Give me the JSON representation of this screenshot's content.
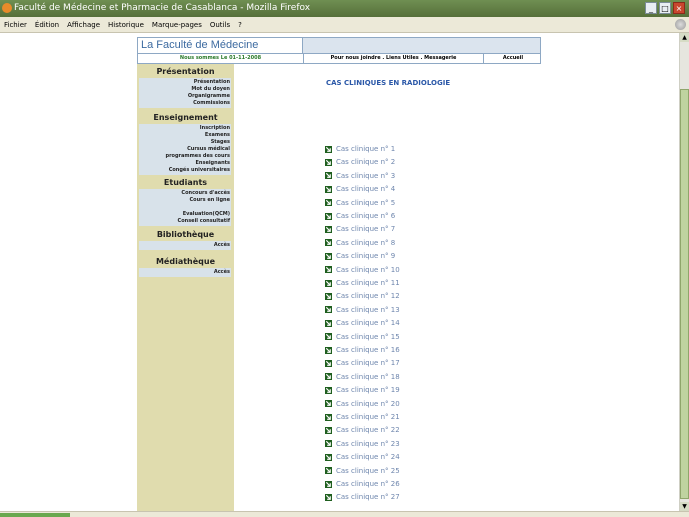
{
  "window": {
    "title": "Faculté de Médecine et Pharmacie de Casablanca - Mozilla Firefox"
  },
  "menu": [
    "Fichier",
    "Édition",
    "Affichage",
    "Historique",
    "Marque-pages",
    "Outils",
    "?"
  ],
  "header": {
    "title": "La Faculté de Médecine",
    "date": "Nous sommes Le 01-11-2008",
    "links": "Pour nous joindre . Liens Utiles . Messagerie",
    "home": "Accueil"
  },
  "sidebar": [
    {
      "title": "Présentation",
      "items": [
        "Présentation",
        "Mot du doyen",
        "Organigramme",
        "Commissions"
      ]
    },
    {
      "title": "Enseignement",
      "items": [
        "Inscription",
        "Examens",
        "Stages",
        "Cursus médical",
        "programmes des cours",
        "Enseignants",
        "Congés universitaires"
      ]
    },
    {
      "title": "Etudiants",
      "items": [
        "Concours d'accès",
        "Cours en ligne",
        "",
        "Evaluation(QCM)",
        "Conseil consultatif"
      ]
    },
    {
      "title": "Bibliothèque",
      "items": [
        "Accès"
      ]
    },
    {
      "title": "Médiathèque",
      "items": [
        "Accès"
      ]
    }
  ],
  "content": {
    "title": "CAS CLINIQUES EN RADIOLOGIE",
    "cases": [
      "Cas clinique n° 1",
      "Cas clinique n° 2",
      "Cas clinique n° 3",
      "Cas clinique n° 4",
      "Cas clinique n° 5",
      "Cas clinique n° 6",
      "Cas clinique n° 7",
      "Cas clinique n° 8",
      "Cas clinique n° 9",
      "Cas clinique n° 10",
      "Cas clinique n° 11",
      "Cas clinique n° 12",
      "Cas clinique n° 13",
      "Cas clinique n° 14",
      "Cas clinique n° 15",
      "Cas clinique n° 16",
      "Cas clinique n° 17",
      "Cas clinique n° 18",
      "Cas clinique n° 19",
      "Cas clinique n° 20",
      "Cas clinique n° 21",
      "Cas clinique n° 22",
      "Cas clinique n° 23",
      "Cas clinique n° 24",
      "Cas clinique n° 25",
      "Cas clinique n° 26",
      "Cas clinique n° 27"
    ]
  },
  "icons": {
    "case_bullet": "green-arrow-icon"
  },
  "colors": {
    "titlebar": "#5e7a44",
    "sidebar": "#e0dcae",
    "sidebar_box": "#d8e2ea",
    "link": "#6e86ad",
    "heading": "#2b58a8"
  }
}
